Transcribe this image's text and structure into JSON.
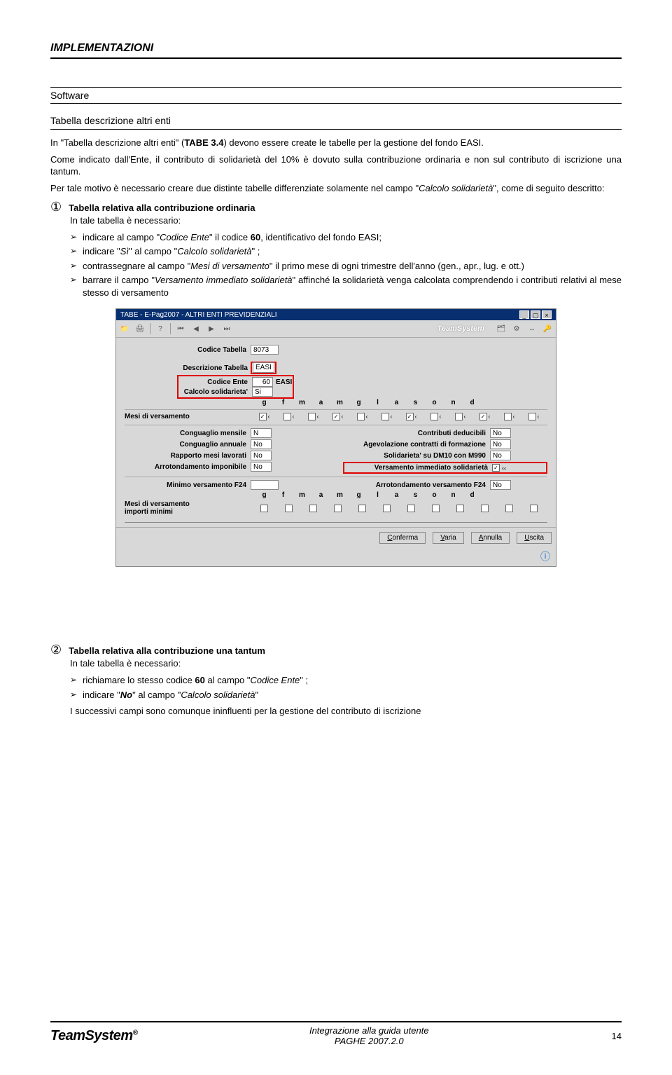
{
  "header": {
    "title": "IMPLEMENTAZIONI"
  },
  "software_label": "Software",
  "section_title": "Tabella descrizione altri enti",
  "p1_a": "In \"Tabella descrizione altri enti\" (",
  "p1_b": "TABE 3.4",
  "p1_c": ") devono essere create le tabelle per la gestione del fondo EASI.",
  "p2": "Come indicato dall'Ente, il contributo di solidarietà del 10% è dovuto sulla contribuzione ordinaria e non sul contributo di iscrizione una tantum.",
  "p3_a": "Per tale motivo è necessario creare due distinte tabelle differenziate solamente nel campo \"",
  "p3_b": "Calcolo solidarietà",
  "p3_c": "\", come di seguito descritto:",
  "n1": {
    "circ": "①",
    "title": "Tabella relativa alla contribuzione ordinaria"
  },
  "p_intro1": "In tale tabella è necessario:",
  "b1": {
    "a": "indicare al campo \"",
    "b": "Codice Ente",
    "c": "\" il codice ",
    "d": "60",
    "e": ", identificativo del fondo EASI;"
  },
  "b2": {
    "a": "indicare \"",
    "b": "Sì",
    "c": "\" al campo \"",
    "d": "Calcolo solidarietà",
    "e": "\" ;"
  },
  "b3": {
    "a": "contrassegnare al campo \"",
    "b": "Mesi di versamento",
    "c": "\" il primo mese di ogni trimestre dell'anno (gen., apr., lug. e ott.)"
  },
  "b4": {
    "a": "barrare il campo \"",
    "b": "Versamento immediato solidarietà",
    "c": "\" affinché la solidarietà venga calcolata comprendendo i contributi relativi al mese stesso di versamento"
  },
  "mock": {
    "title": "TABE  - E-Pag2007  -  ALTRI ENTI PREVIDENZIALI",
    "brand": "TeamSystem",
    "codice_tabella_lbl": "Codice Tabella",
    "codice_tabella_val": "8073",
    "descrizione_lbl": "Descrizione Tabella",
    "descrizione_val": "EASI",
    "codice_ente_lbl": "Codice Ente",
    "codice_ente_val": "60",
    "codice_ente_txt": "EASI",
    "calc_sol_lbl": "Calcolo solidarieta'",
    "calc_sol_val": "Si",
    "months": [
      "g",
      "f",
      "m",
      "a",
      "m",
      "g",
      "l",
      "a",
      "s",
      "o",
      "n",
      "d"
    ],
    "mesi_vers_lbl": "Mesi di versamento",
    "mesi_checks": [
      true,
      false,
      false,
      true,
      false,
      false,
      true,
      false,
      false,
      true,
      false,
      false
    ],
    "left_rows": [
      {
        "lbl": "Conguaglio mensile",
        "val": "N"
      },
      {
        "lbl": "Conguaglio annuale",
        "val": "No"
      },
      {
        "lbl": "Rapporto mesi lavorati",
        "val": "No"
      },
      {
        "lbl": "Arrotondamento imponibile",
        "val": "No"
      }
    ],
    "right_rows": [
      {
        "lbl": "Contributi deducibili",
        "val": "No"
      },
      {
        "lbl": "Agevolazione contratti di formazione",
        "val": "No"
      },
      {
        "lbl": "Solidarieta' su DM10 con M990",
        "val": "No"
      }
    ],
    "vers_imm_lbl": "Versamento immediato solidarietà",
    "min_f24_lbl": "Minimo versamento F24",
    "arr_f24_lbl": "Arrotondamento versamento F24",
    "arr_f24_val": "No",
    "mesi_min_lbl": "Mesi di versamento importi minimi",
    "btns": {
      "conferma": "Conferma",
      "varia": "Varia",
      "annulla": "Annulla",
      "uscita": "Uscita"
    }
  },
  "n2": {
    "circ": "②",
    "title": "Tabella relativa alla contribuzione una tantum"
  },
  "p_intro2": "In tale tabella è necessario:",
  "c1": {
    "a": "richiamare lo stesso codice ",
    "b": "60",
    "c": " al campo \"",
    "d": "Codice Ente",
    "e": "\" ;"
  },
  "c2": {
    "a": "indicare \"",
    "b": "No",
    "c": "\" al campo \"",
    "d": "Calcolo solidarietà",
    "e": "\""
  },
  "p_last": "I successivi campi sono comunque ininfluenti per la gestione del contributo di iscrizione",
  "footer": {
    "logo": "TeamSystem",
    "reg": "®",
    "line1": "Integrazione alla guida utente",
    "line2": "PAGHE 2007.2.0",
    "page": "14"
  }
}
